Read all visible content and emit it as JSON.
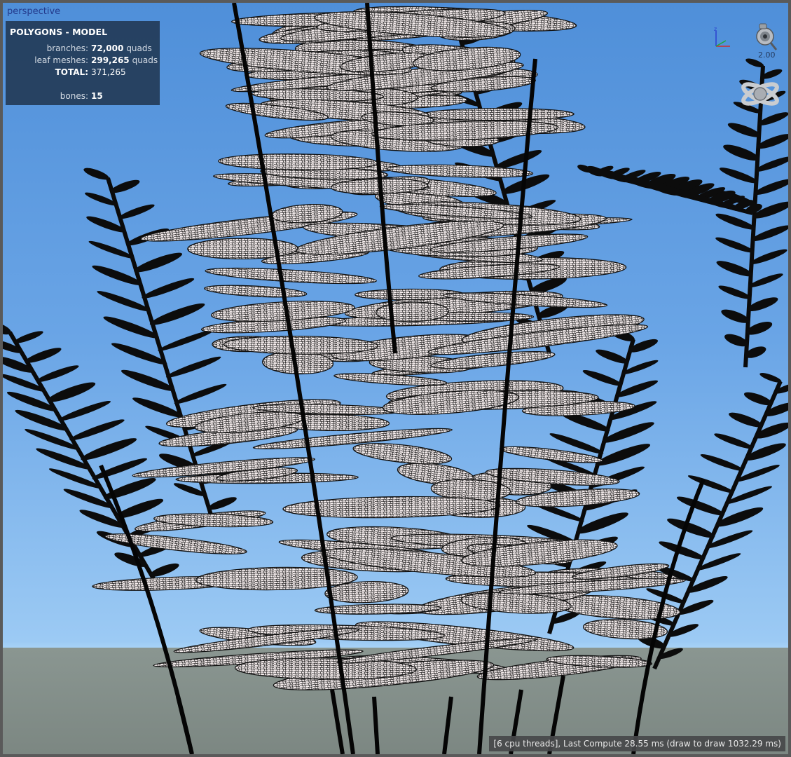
{
  "viewport": {
    "view_label": "perspective",
    "sky_color": "#5b98de",
    "ground_color": "#86928d"
  },
  "stats": {
    "title": "POLYGONS - MODEL",
    "branches_label": "branches:",
    "branches_value": "72,000",
    "branches_unit": "quads",
    "leaf_meshes_label": "leaf meshes:",
    "leaf_meshes_value": "299,265",
    "leaf_meshes_unit": "quads",
    "total_label": "TOTAL:",
    "total_value": "371,265",
    "bones_label": "bones:",
    "bones_value": "15"
  },
  "gizmo": {
    "zoom_value": "2.00",
    "axis_icon": "axis-gizmo-icon",
    "camera_icon": "camera-zoom-icon",
    "orbit_icon": "orbit-icon"
  },
  "status": {
    "text": "[6 cpu threads], Last Compute 28.55 ms (draw to draw 1032.29 ms)"
  }
}
